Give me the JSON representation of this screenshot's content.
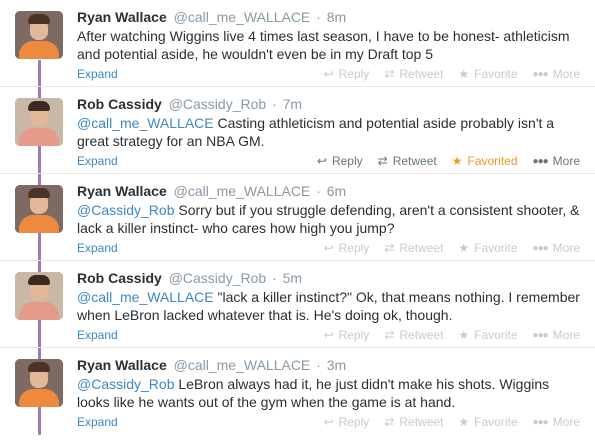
{
  "tweets": [
    {
      "name": "Ryan Wallace",
      "handle": "@call_me_WALLACE",
      "time": "8m",
      "text_mention": "",
      "text_rest": "After watching Wiggins live 4 times last season, I have to be honest- athleticism and potential aside, he wouldn't even be in my Draft top 5",
      "expand": "Expand",
      "reply": "Reply",
      "retweet": "Retweet",
      "favorite": "Favorite",
      "more": "More",
      "favorited": false,
      "actions_visible": false
    },
    {
      "name": "Rob Cassidy",
      "handle": "@Cassidy_Rob",
      "time": "7m",
      "text_mention": "@call_me_WALLACE",
      "text_rest": " Casting athleticism and potential aside probably isn't a great strategy for an NBA GM.",
      "expand": "Expand",
      "reply": "Reply",
      "retweet": "Retweet",
      "favorite": "Favorited",
      "more": "More",
      "favorited": true,
      "actions_visible": true
    },
    {
      "name": "Ryan Wallace",
      "handle": "@call_me_WALLACE",
      "time": "6m",
      "text_mention": "@Cassidy_Rob",
      "text_rest": " Sorry but if you struggle defending, aren't a consistent shooter, & lack a killer instinct- who cares how high you jump?",
      "expand": "Expand",
      "reply": "Reply",
      "retweet": "Retweet",
      "favorite": "Favorite",
      "more": "More",
      "favorited": false,
      "actions_visible": false
    },
    {
      "name": "Rob Cassidy",
      "handle": "@Cassidy_Rob",
      "time": "5m",
      "text_mention": "@call_me_WALLACE",
      "text_rest": " \"lack a killer instinct?\"  Ok, that means nothing. I remember when LeBron lacked whatever that is. He's doing ok, though.",
      "expand": "Expand",
      "reply": "Reply",
      "retweet": "Retweet",
      "favorite": "Favorite",
      "more": "More",
      "favorited": false,
      "actions_visible": false
    },
    {
      "name": "Ryan Wallace",
      "handle": "@call_me_WALLACE",
      "time": "3m",
      "text_mention": "@Cassidy_Rob",
      "text_rest": " LeBron always had it, he just didn't make his shots. Wiggins looks like he wants out of the gym when the game is at hand.",
      "expand": "Expand",
      "reply": "Reply",
      "retweet": "Retweet",
      "favorite": "Favorite",
      "more": "More",
      "favorited": false,
      "actions_visible": false
    }
  ],
  "colors": {
    "link": "#3b88c3",
    "thread_line": "#9c7ab8",
    "favorited": "#f09824",
    "muted": "#8899a6"
  }
}
